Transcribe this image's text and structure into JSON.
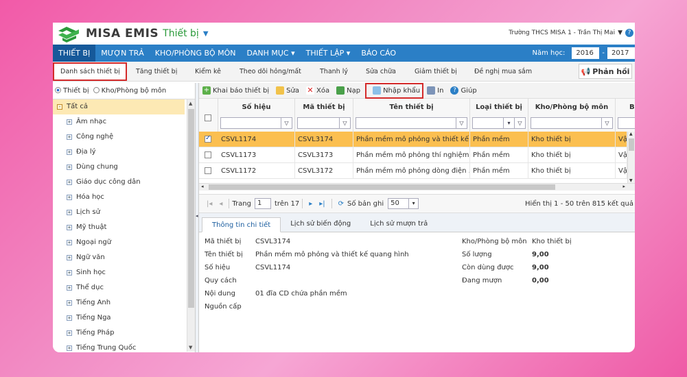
{
  "header": {
    "brand": "MISA EMIS",
    "module": "Thiết bị",
    "user_text": "Trường THCS MISA 1 - Trần Thị Mai"
  },
  "menu": {
    "items": [
      "THIẾT BỊ",
      "MƯỢN TRẢ",
      "KHO/PHÒNG BỘ MÔN",
      "DANH MỤC ▾",
      "THIẾT LẬP ▾",
      "BÁO CÁO"
    ],
    "year_label": "Năm học:",
    "year_from": "2016",
    "year_to": "2017"
  },
  "subtabs": {
    "items": [
      "Danh sách thiết bị",
      "Tăng thiết bị",
      "Kiểm kê",
      "Theo dõi hỏng/mất",
      "Thanh lý",
      "Sửa chữa",
      "Giảm thiết bị",
      "Đề nghị mua sắm"
    ],
    "feedback": "Phản hồi"
  },
  "sidebar": {
    "radio1": "Thiết bị",
    "radio2": "Kho/Phòng bộ môn",
    "root": "Tất cả",
    "items": [
      "Âm nhạc",
      "Công nghệ",
      "Địa lý",
      "Dùng chung",
      "Giáo dục công dân",
      "Hóa học",
      "Lịch sử",
      "Mỹ thuật",
      "Ngoại ngữ",
      "Ngữ văn",
      "Sinh học",
      "Thể dục",
      "Tiếng Anh",
      "Tiếng Nga",
      "Tiếng Pháp",
      "Tiếng Trung Quốc"
    ]
  },
  "toolbar": {
    "declare": "Khai báo thiết bị",
    "edit": "Sửa",
    "delete": "Xóa",
    "load": "Nạp",
    "import": "Nhập khẩu",
    "print": "In",
    "help": "Giúp"
  },
  "grid": {
    "columns": [
      "Số hiệu",
      "Mã thiết bị",
      "Tên thiết bị",
      "Loại thiết bị",
      "Kho/Phòng bộ môn",
      "B"
    ],
    "rows": [
      {
        "so_hieu": "CSVL1174",
        "ma": "CSVL3174",
        "ten": "Phần mềm mô phỏng và thiết kế...",
        "loai": "Phần mềm",
        "kho": "Kho thiết bị",
        "extra": "Vậ",
        "checked": true
      },
      {
        "so_hieu": "CSVL1173",
        "ma": "CSVL3173",
        "ten": "Phần mềm mô phỏng thí nghiệm...",
        "loai": "Phần mềm",
        "kho": "Kho thiết bị",
        "extra": "Vậ",
        "checked": false
      },
      {
        "so_hieu": "CSVL1172",
        "ma": "CSVL3172",
        "ten": "Phần mềm mô phỏng dòng điện ...",
        "loai": "Phần mềm",
        "kho": "Kho thiết bị",
        "extra": "Vậ",
        "checked": false
      }
    ]
  },
  "pager": {
    "page_label": "Trang",
    "page": "1",
    "of_label": "trên 17",
    "records_label": "Số bản ghi",
    "records": "50",
    "info": "Hiển thị 1 - 50 trên 815 kết quả"
  },
  "detail_tabs": [
    "Thông tin chi tiết",
    "Lịch sử biến động",
    "Lịch sử mượn trả"
  ],
  "detail": {
    "left": [
      {
        "label": "Mã thiết bị",
        "value": "CSVL3174"
      },
      {
        "label": "Tên thiết bị",
        "value": "Phần mềm mô phỏng và thiết kế quang hình"
      },
      {
        "label": "Số hiệu",
        "value": "CSVL1174"
      },
      {
        "label": "Quy cách",
        "value": ""
      },
      {
        "label": "Nội dung",
        "value": "01 đĩa CD chứa phần mềm"
      },
      {
        "label": "Nguồn cấp",
        "value": ""
      }
    ],
    "right": [
      {
        "label": "Kho/Phòng bộ môn",
        "value": "Kho thiết bị"
      },
      {
        "label": "Số lượng",
        "value": "9,00"
      },
      {
        "label": "Còn dùng được",
        "value": "9,00"
      },
      {
        "label": "Đang mượn",
        "value": "0,00"
      }
    ]
  },
  "colors": {
    "primary": "#2b7fc6",
    "selected_row": "#fbbf50",
    "highlight_border": "#d42a2a"
  }
}
